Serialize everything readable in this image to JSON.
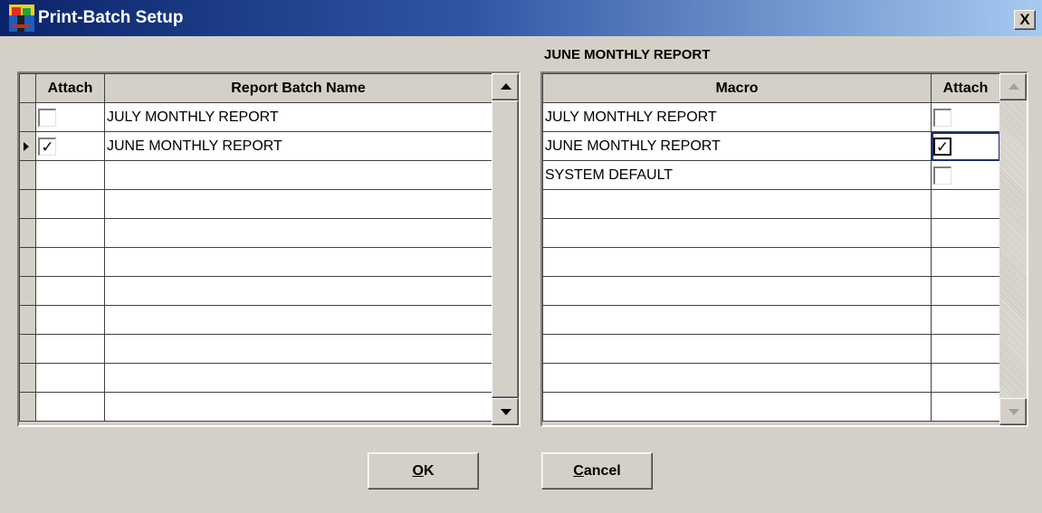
{
  "window": {
    "title": "Print-Batch Setup",
    "close_glyph": "X",
    "icon": "app-icon"
  },
  "batch_grid": {
    "headers": {
      "attach": "Attach",
      "name": "Report Batch Name"
    },
    "rows": [
      {
        "attach": false,
        "name": "JULY MONTHLY REPORT",
        "current": false
      },
      {
        "attach": true,
        "name": "JUNE MONTHLY REPORT",
        "current": true
      },
      {
        "attach": null,
        "name": ""
      },
      {
        "attach": null,
        "name": ""
      },
      {
        "attach": null,
        "name": ""
      },
      {
        "attach": null,
        "name": ""
      },
      {
        "attach": null,
        "name": ""
      },
      {
        "attach": null,
        "name": ""
      },
      {
        "attach": null,
        "name": ""
      },
      {
        "attach": null,
        "name": ""
      },
      {
        "attach": null,
        "name": ""
      }
    ]
  },
  "macro_section": {
    "title": "JUNE MONTHLY REPORT",
    "headers": {
      "macro": "Macro",
      "attach": "Attach"
    },
    "rows": [
      {
        "macro": "JULY MONTHLY REPORT",
        "attach": false
      },
      {
        "macro": "JUNE MONTHLY REPORT",
        "attach": true,
        "focused": true
      },
      {
        "macro": "SYSTEM DEFAULT",
        "attach": false
      },
      {
        "macro": "",
        "attach": null
      },
      {
        "macro": "",
        "attach": null
      },
      {
        "macro": "",
        "attach": null
      },
      {
        "macro": "",
        "attach": null
      },
      {
        "macro": "",
        "attach": null
      },
      {
        "macro": "",
        "attach": null
      },
      {
        "macro": "",
        "attach": null
      },
      {
        "macro": "",
        "attach": null
      }
    ]
  },
  "buttons": {
    "ok": {
      "mnemonic": "O",
      "rest": "K"
    },
    "cancel": {
      "mnemonic": "C",
      "rest": "ancel"
    }
  },
  "check_glyph": "✓"
}
